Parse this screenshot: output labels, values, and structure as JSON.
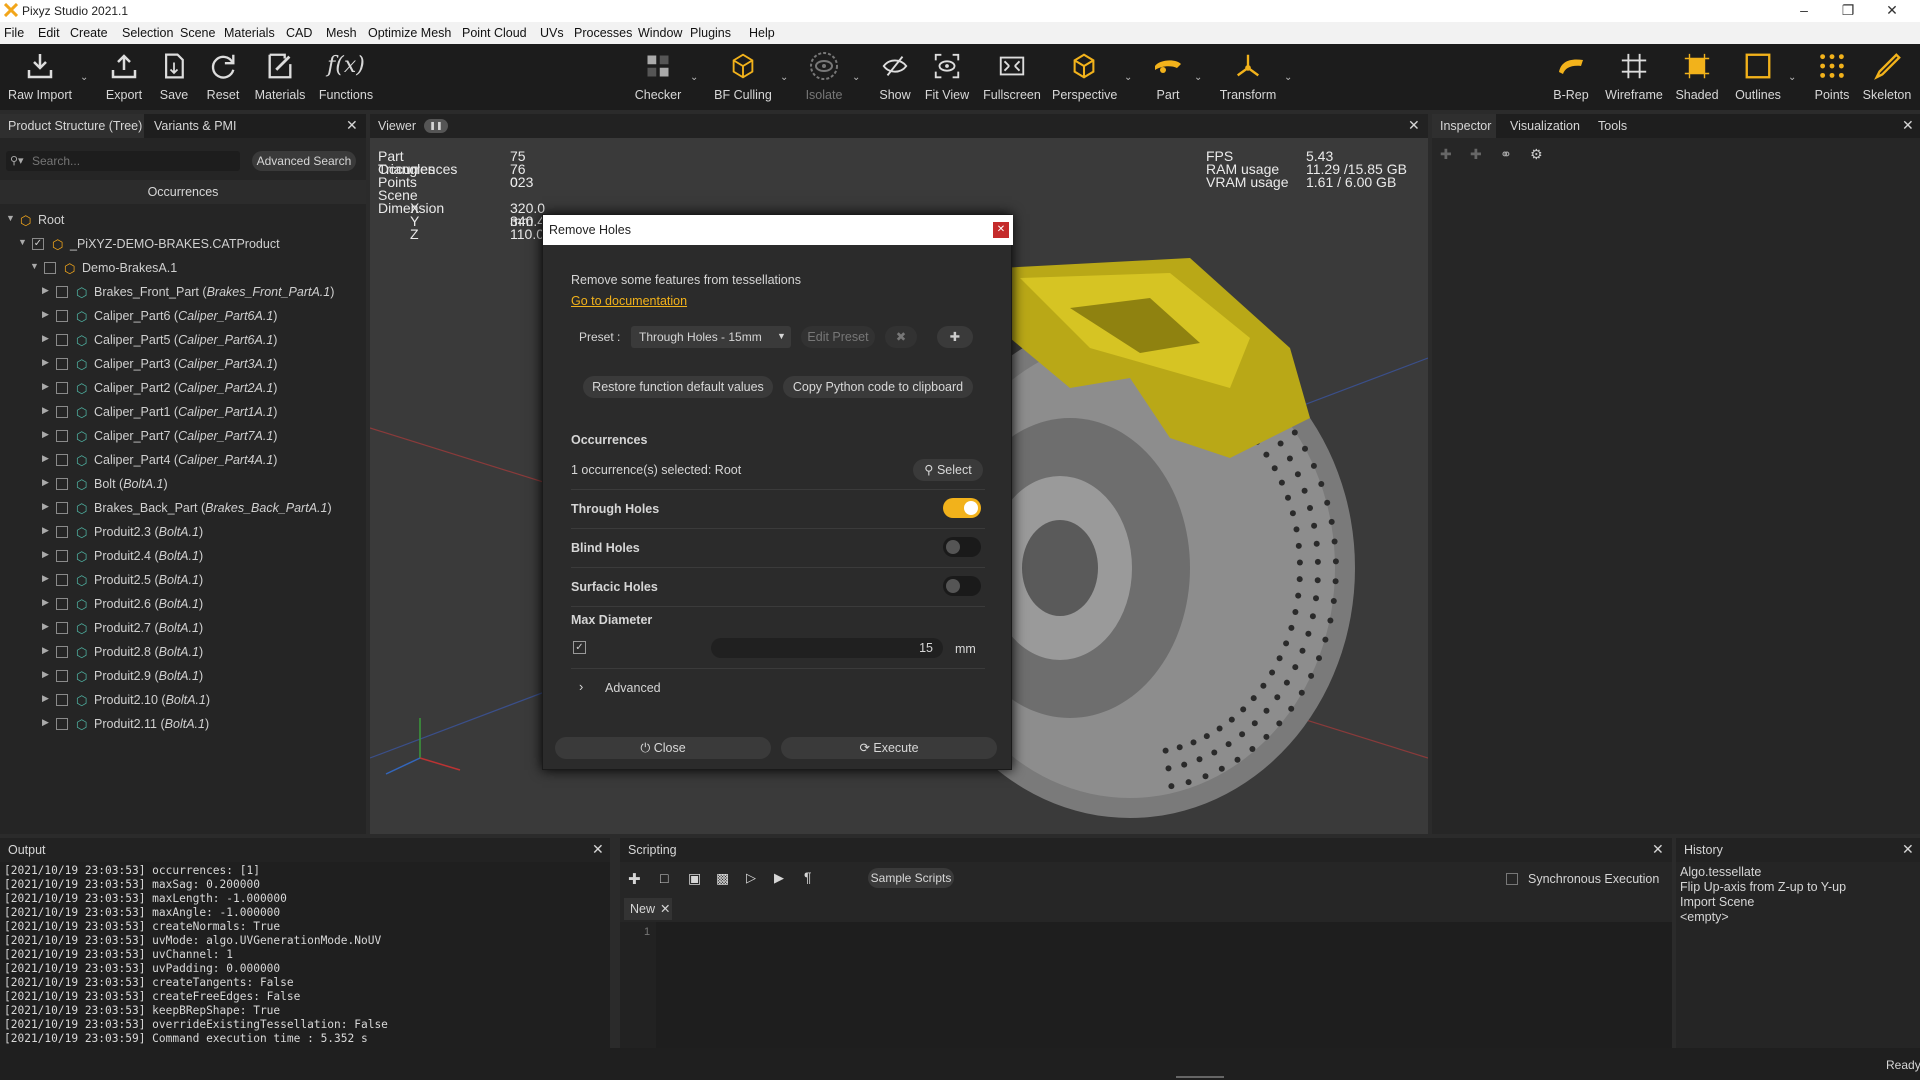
{
  "app": {
    "title": "Pixyz Studio 2021.1"
  },
  "menu": [
    "File",
    "Edit",
    "Create",
    "Selection",
    "Scene",
    "Materials",
    "CAD",
    "Mesh",
    "Optimize Mesh",
    "Point Cloud",
    "UVs",
    "Processes",
    "Window",
    "Plugins",
    "Help"
  ],
  "toolbar": {
    "left": [
      "Raw Import",
      "Export",
      "Save",
      "Reset",
      "Materials",
      "Functions"
    ],
    "center": [
      "Checker",
      "BF Culling",
      "Isolate",
      "Show",
      "Fit View",
      "Fullscreen",
      "Perspective",
      "Part",
      "Transform"
    ],
    "right": [
      "B-Rep",
      "Wireframe",
      "Shaded",
      "Outlines",
      "Points",
      "Skeleton"
    ],
    "functions_glyph": "f(x)"
  },
  "left": {
    "tabs": [
      "Product Structure (Tree)",
      "Variants & PMI"
    ],
    "search_placeholder": "Search...",
    "advanced_search": "Advanced Search",
    "header": "Occurrences",
    "tree": [
      {
        "n": "Root",
        "it": ""
      },
      {
        "n": "_PiXYZ-DEMO-BRAKES.CATProduct",
        "it": ""
      },
      {
        "n": "Demo-BrakesA.1",
        "it": ""
      },
      {
        "n": "Brakes_Front_Part",
        "it": "Brakes_Front_PartA.1"
      },
      {
        "n": "Caliper_Part6",
        "it": "Caliper_Part6A.1"
      },
      {
        "n": "Caliper_Part5",
        "it": "Caliper_Part6A.1"
      },
      {
        "n": "Caliper_Part3",
        "it": "Caliper_Part3A.1"
      },
      {
        "n": "Caliper_Part2",
        "it": "Caliper_Part2A.1"
      },
      {
        "n": "Caliper_Part1",
        "it": "Caliper_Part1A.1"
      },
      {
        "n": "Caliper_Part7",
        "it": "Caliper_Part7A.1"
      },
      {
        "n": "Caliper_Part4",
        "it": "Caliper_Part4A.1"
      },
      {
        "n": "Bolt",
        "it": "BoltA.1"
      },
      {
        "n": "Brakes_Back_Part",
        "it": "Brakes_Back_PartA.1"
      },
      {
        "n": "Produit2.3",
        "it": "BoltA.1"
      },
      {
        "n": "Produit2.4",
        "it": "BoltA.1"
      },
      {
        "n": "Produit2.5",
        "it": "BoltA.1"
      },
      {
        "n": "Produit2.6",
        "it": "BoltA.1"
      },
      {
        "n": "Produit2.7",
        "it": "BoltA.1"
      },
      {
        "n": "Produit2.8",
        "it": "BoltA.1"
      },
      {
        "n": "Produit2.9",
        "it": "BoltA.1"
      },
      {
        "n": "Produit2.10",
        "it": "BoltA.1"
      },
      {
        "n": "Produit2.11",
        "it": "BoltA.1"
      }
    ]
  },
  "viewer": {
    "tab": "Viewer",
    "stats_labels": [
      "Part Occurrences",
      "Triangles",
      "Points",
      "Scene Dimension",
      "X",
      "Y",
      "Z"
    ],
    "stats_values": [
      "75",
      "76 023",
      "0",
      "",
      "320.0 mm",
      "340.4",
      "110.0"
    ],
    "perf_labels": [
      "FPS",
      "RAM usage",
      "VRAM usage"
    ],
    "perf_values": [
      "5.43",
      "11.29 /15.85 GB",
      "1.61 / 6.00 GB"
    ]
  },
  "dialog": {
    "title": "Remove Holes",
    "desc": "Remove some features from tessellations",
    "doc_link": "Go to documentation",
    "preset_label": "Preset :",
    "preset_value": "Through Holes - 15mm",
    "edit_preset": "Edit Preset",
    "restore": "Restore function default values",
    "copy_python": "Copy Python code to clipboard",
    "occ_title": "Occurrences",
    "occ_sel": "1 occurrence(s) selected: Root",
    "select": "Select",
    "through": "Through Holes",
    "blind": "Blind Holes",
    "surfacic": "Surfacic Holes",
    "max_diam": "Max Diameter",
    "diam_value": "15",
    "unit": "mm",
    "advanced": "Advanced",
    "close": "Close",
    "execute": "Execute",
    "through_on": true,
    "blind_on": false,
    "surfacic_on": false
  },
  "right": {
    "tabs": [
      "Inspector",
      "Visualization",
      "Tools"
    ]
  },
  "output": {
    "tab": "Output",
    "lines": [
      "[2021/10/19 23:03:53] occurrences: [1]",
      "[2021/10/19 23:03:53] maxSag: 0.200000",
      "[2021/10/19 23:03:53] maxLength: -1.000000",
      "[2021/10/19 23:03:53] maxAngle: -1.000000",
      "[2021/10/19 23:03:53] createNormals: True",
      "[2021/10/19 23:03:53] uvMode: algo.UVGenerationMode.NoUV",
      "[2021/10/19 23:03:53] uvChannel: 1",
      "[2021/10/19 23:03:53] uvPadding: 0.000000",
      "[2021/10/19 23:03:53] createTangents: False",
      "[2021/10/19 23:03:53] createFreeEdges: False",
      "[2021/10/19 23:03:53] keepBRepShape: True",
      "[2021/10/19 23:03:53] overrideExistingTessellation: False",
      "[2021/10/19 23:03:59] Command execution time : 5.352 s"
    ]
  },
  "scripting": {
    "tab": "Scripting",
    "sample": "Sample Scripts",
    "sync": "Synchronous Execution",
    "new_tab": "New",
    "line1": "1"
  },
  "history": {
    "tab": "History",
    "items": [
      "Algo.tessellate",
      "Flip Up-axis from Z-up to Y-up",
      "Import Scene",
      "<empty>"
    ]
  },
  "status": {
    "text": "Ready"
  },
  "colors": {
    "accent": "#f2b21b",
    "part": "#c8b619"
  }
}
